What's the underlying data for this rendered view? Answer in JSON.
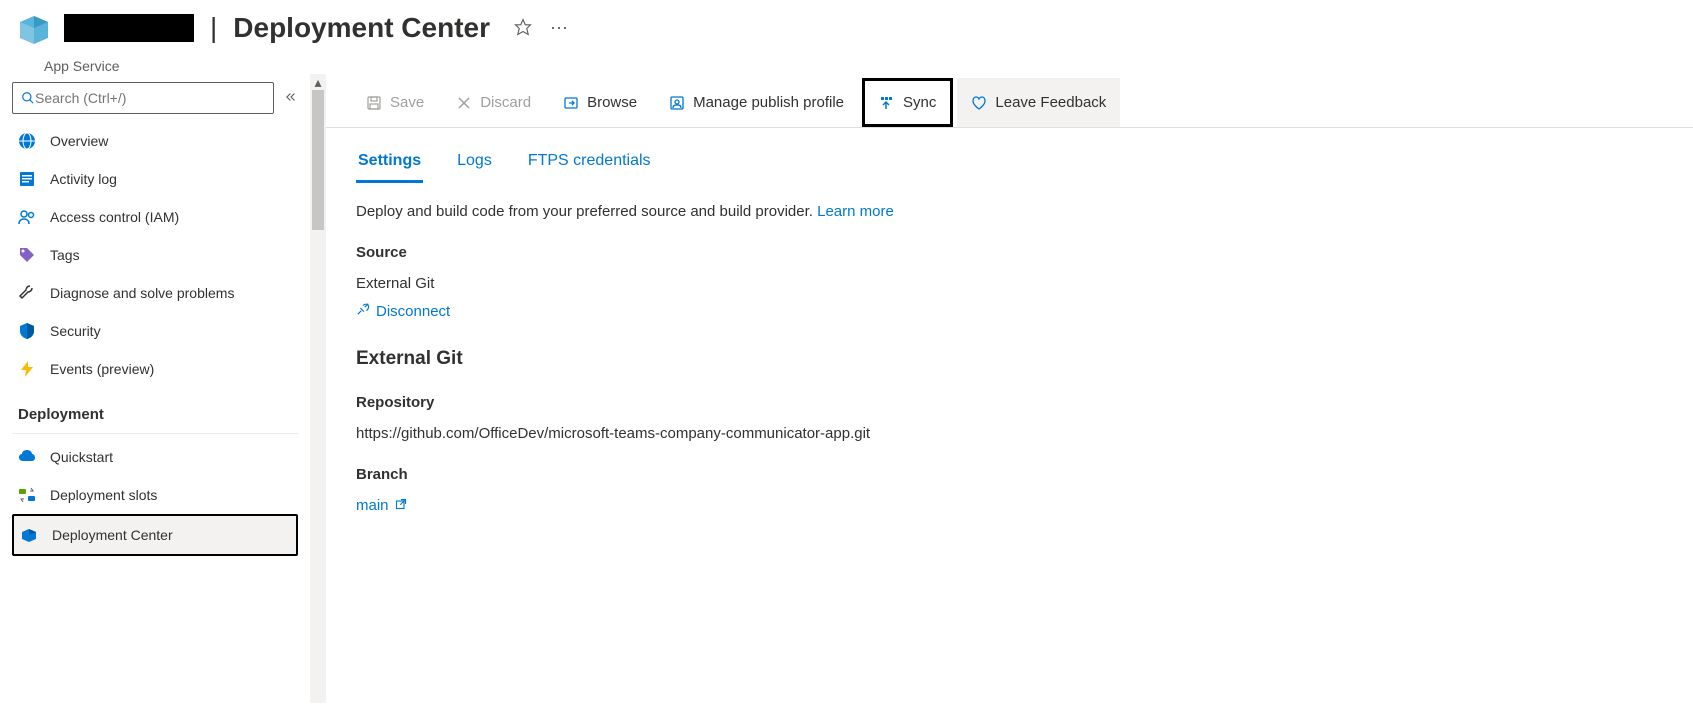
{
  "header": {
    "page_title": "Deployment Center",
    "subtitle": "App Service"
  },
  "sidebar": {
    "search_placeholder": "Search (Ctrl+/)",
    "items": [
      {
        "label": "Overview"
      },
      {
        "label": "Activity log"
      },
      {
        "label": "Access control (IAM)"
      },
      {
        "label": "Tags"
      },
      {
        "label": "Diagnose and solve problems"
      },
      {
        "label": "Security"
      },
      {
        "label": "Events (preview)"
      }
    ],
    "section_header": "Deployment",
    "deploy_items": [
      {
        "label": "Quickstart"
      },
      {
        "label": "Deployment slots"
      },
      {
        "label": "Deployment Center"
      }
    ]
  },
  "toolbar": {
    "save": "Save",
    "discard": "Discard",
    "browse": "Browse",
    "manage": "Manage publish profile",
    "sync": "Sync",
    "feedback": "Leave Feedback"
  },
  "tabs": {
    "settings": "Settings",
    "logs": "Logs",
    "ftps": "FTPS credentials"
  },
  "content": {
    "description": "Deploy and build code from your preferred source and build provider. ",
    "learn_more": "Learn more",
    "source_label": "Source",
    "source_value": "External Git",
    "disconnect": "Disconnect",
    "ext_heading": "External Git",
    "repo_label": "Repository",
    "repo_value": "https://github.com/OfficeDev/microsoft-teams-company-communicator-app.git",
    "branch_label": "Branch",
    "branch_value": "main"
  }
}
